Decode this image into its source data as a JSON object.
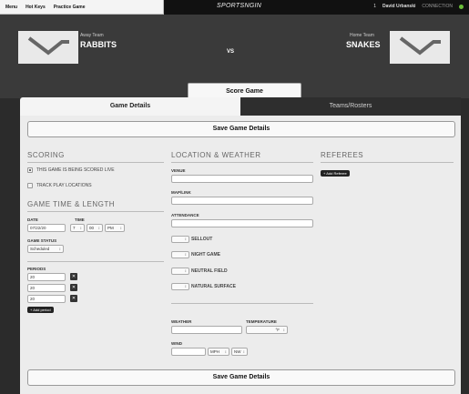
{
  "topbar": {
    "menu": [
      "Menu",
      "Hot Keys",
      "Practice Game"
    ],
    "brand": "SPORTSNGIN",
    "user_icon_count": "1",
    "user_name": "David Urbanski",
    "connection": "CONNECTION"
  },
  "hero": {
    "away_caption": "Away Team",
    "away_name": "RABBITS",
    "vs": "VS",
    "home_caption": "Home Team",
    "home_name": "SNAKES",
    "score_button": "Score Game"
  },
  "tabs": {
    "active": "Game Details",
    "inactive": "Teams/Rosters"
  },
  "save_label": "Save Game Details",
  "scoring": {
    "title": "SCORING",
    "live_label": "THIS GAME IS BEING SCORED LIVE",
    "track_label": "TRACK PLAY LOCATIONS"
  },
  "game_time": {
    "title": "GAME TIME & LENGTH",
    "date_label": "DATE",
    "date_value": "07/22/20",
    "time_label": "TIME",
    "hour": "7",
    "minute": "00",
    "ampm": "PM",
    "status_label": "GAME STATUS",
    "status_value": "Scheduled",
    "periods_label": "PERIODS",
    "periods": [
      "20",
      "20",
      "20"
    ],
    "add_period": "+ Add period"
  },
  "location": {
    "title": "LOCATION & WEATHER",
    "venue_label": "VENUE",
    "map_label": "MAP/LINK",
    "attendance_label": "ATTENDANCE",
    "toggles": [
      "SELLOUT",
      "NIGHT GAME",
      "NEUTRAL FIELD",
      "NATURAL SURFACE"
    ],
    "weather_label": "WEATHER",
    "temperature_label": "TEMPERATURE",
    "temp_unit": "°F",
    "wind_label": "WIND",
    "wind_unit": "MPH",
    "wind_dir": "NW"
  },
  "referees": {
    "title": "REFEREES",
    "add_button": "+ Add Referee"
  }
}
